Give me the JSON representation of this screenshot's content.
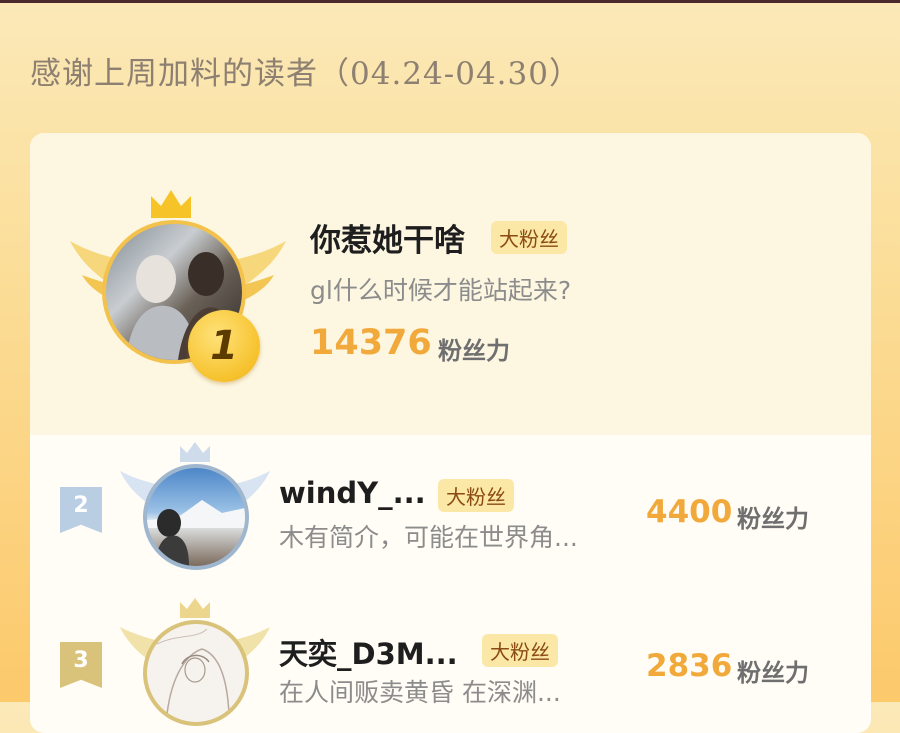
{
  "header": {
    "title": "感谢上周加料的读者（04.24-04.30）"
  },
  "colors": {
    "accent": "#f2a93b",
    "badge_bg": "#fbe7a6"
  },
  "fans": [
    {
      "rank": "1",
      "name": "你惹她干啥",
      "badge": "大粉丝",
      "bio": "gl什么时候才能站起来?",
      "score": "14376",
      "score_unit": "粉丝力"
    },
    {
      "rank": "2",
      "name": "windY_...",
      "badge": "大粉丝",
      "bio": "木有简介，可能在世界角...",
      "score": "4400",
      "score_unit": "粉丝力"
    },
    {
      "rank": "3",
      "name": "天奕_D3M...",
      "badge": "大粉丝",
      "bio": "在人间贩卖黄昏 在深渊...",
      "score": "2836",
      "score_unit": "粉丝力"
    }
  ]
}
